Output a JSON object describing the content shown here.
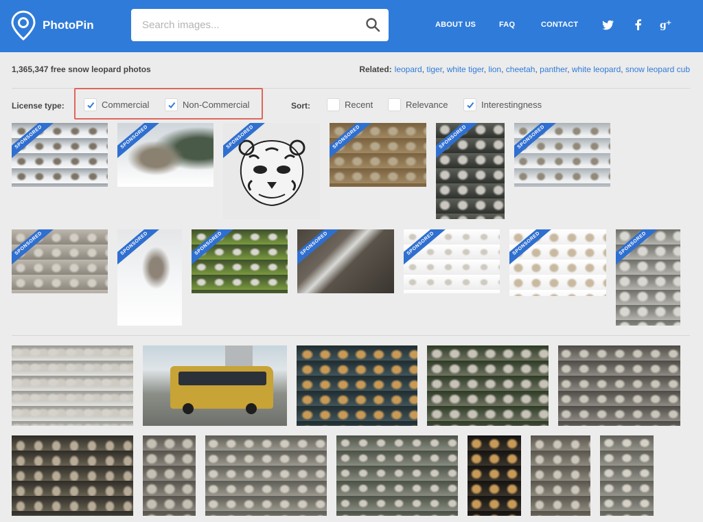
{
  "header": {
    "brand": "PhotoPin",
    "search_placeholder": "Search images...",
    "nav": [
      "ABOUT US",
      "FAQ",
      "CONTACT"
    ],
    "social_icons": [
      "twitter-icon",
      "facebook-icon",
      "google-plus-icon"
    ],
    "bg_color": "#2f7bd9"
  },
  "results": {
    "count_text": "1,365,347 free snow leopard photos",
    "related_label": "Related:",
    "related": [
      "leopard",
      "tiger",
      "white tiger",
      "lion",
      "cheetah",
      "panther",
      "white leopard",
      "snow leopard cub"
    ]
  },
  "filters": {
    "license_label": "License type:",
    "license": [
      {
        "label": "Commercial",
        "checked": true
      },
      {
        "label": "Non-Commercial",
        "checked": true
      }
    ],
    "sort_label": "Sort:",
    "sort": [
      {
        "label": "Recent",
        "checked": false
      },
      {
        "label": "Relevance",
        "checked": false
      },
      {
        "label": "Interestingness",
        "checked": true
      }
    ],
    "highlight_color": "#e0645c"
  },
  "badge_text": "SPONSORED",
  "photos": [
    {
      "row": 1,
      "sponsored": true,
      "subject": "snow leopard on snowy hillside"
    },
    {
      "row": 1,
      "sponsored": true,
      "subject": "snow leopard walking in snow"
    },
    {
      "row": 1,
      "sponsored": true,
      "subject": "snow leopard face illustration"
    },
    {
      "row": 1,
      "sponsored": true,
      "subject": "snow leopard cub lying"
    },
    {
      "row": 1,
      "sponsored": true,
      "subject": "snow leopard lying on rock"
    },
    {
      "row": 1,
      "sponsored": true,
      "subject": "snow leopard in snow"
    },
    {
      "row": 2,
      "sponsored": true,
      "subject": "snow leopard cubs on rock"
    },
    {
      "row": 2,
      "sponsored": true,
      "subject": "snow leopard jumping in snow"
    },
    {
      "row": 2,
      "sponsored": true,
      "subject": "snow leopard cub in grass"
    },
    {
      "row": 2,
      "sponsored": true,
      "subject": "snow leopard on rocks"
    },
    {
      "row": 2,
      "sponsored": true,
      "subject": "snow leopard running"
    },
    {
      "row": 2,
      "sponsored": true,
      "subject": "snow leopard cub snarling"
    },
    {
      "row": 2,
      "sponsored": true,
      "subject": "snow leopard portrait"
    },
    {
      "row": 3,
      "sponsored": false,
      "subject": "two snow leopards"
    },
    {
      "row": 3,
      "sponsored": false,
      "subject": "yellow bus on street"
    },
    {
      "row": 3,
      "sponsored": false,
      "subject": "snow leopard yawning"
    },
    {
      "row": 3,
      "sponsored": false,
      "subject": "snow leopards playing"
    },
    {
      "row": 3,
      "sponsored": false,
      "subject": "snow leopards on rocks"
    },
    {
      "row": 4,
      "sponsored": false,
      "subject": "snow leopard resting on rocks"
    },
    {
      "row": 4,
      "sponsored": false,
      "subject": "snow leopard sitting"
    },
    {
      "row": 4,
      "sponsored": false,
      "subject": "snow leopard lying among rocks"
    },
    {
      "row": 4,
      "sponsored": false,
      "subject": "snow leopard on rocks"
    },
    {
      "row": 4,
      "sponsored": false,
      "subject": "snow leopard in dark"
    },
    {
      "row": 4,
      "sponsored": false,
      "subject": "snow leopard lounging"
    },
    {
      "row": 4,
      "sponsored": false,
      "subject": "snow leopard on boulder"
    }
  ]
}
